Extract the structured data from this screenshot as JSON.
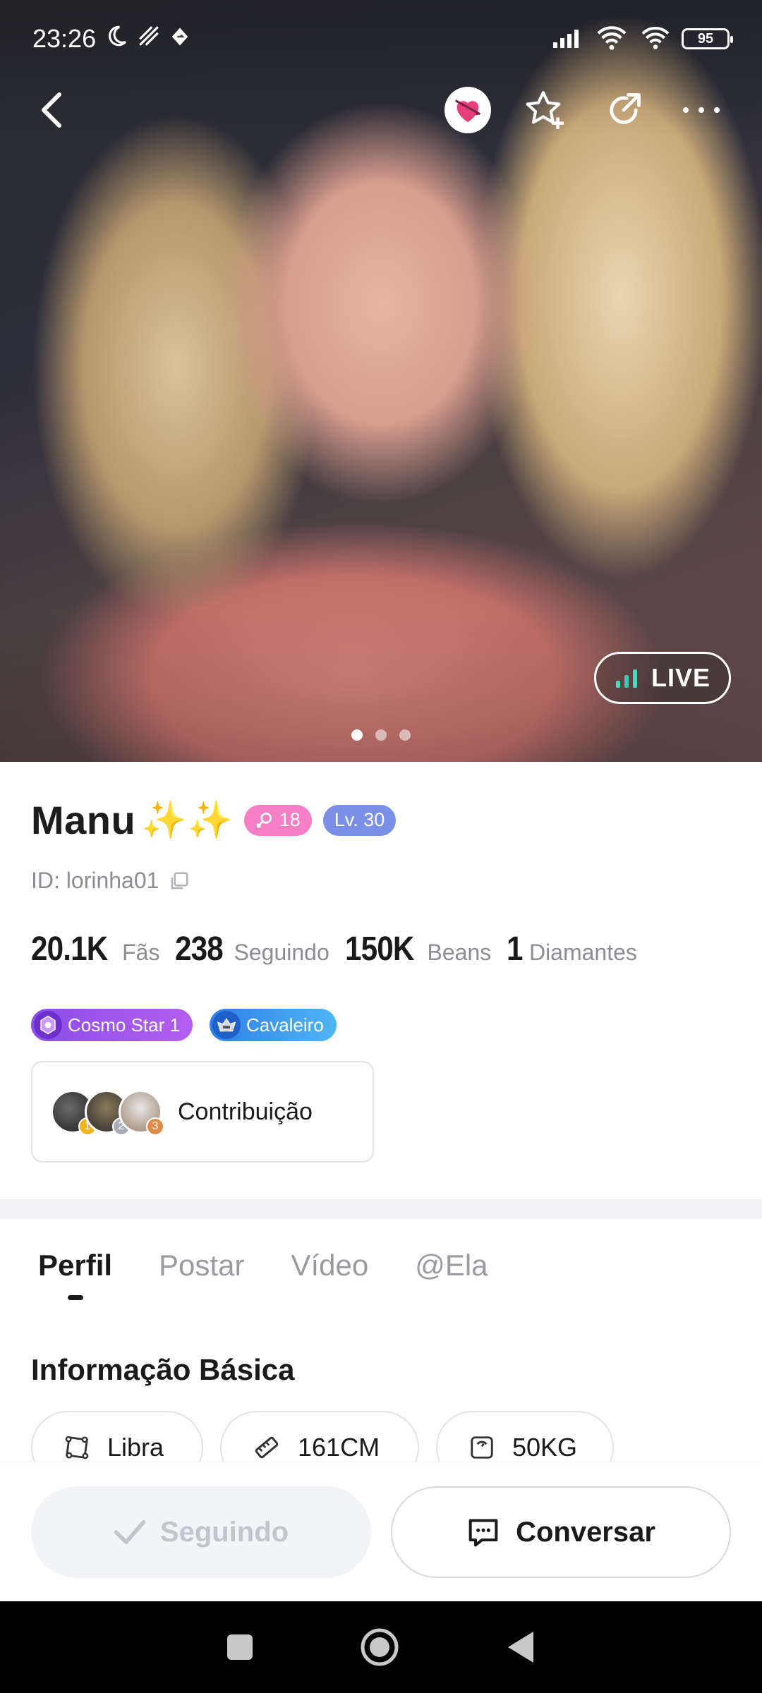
{
  "status_bar": {
    "time": "23:26",
    "battery": "95"
  },
  "live": {
    "label": "LIVE"
  },
  "profile": {
    "name": "Manu",
    "name_emoji": "✨✨",
    "gender_age_badge": "18",
    "level_badge": "Lv. 30",
    "id_text": "ID: lorinha01"
  },
  "stats": [
    {
      "value": "20.1K",
      "label": "Fãs"
    },
    {
      "value": "238",
      "label": "Seguindo"
    },
    {
      "value": "150K",
      "label": "Beans"
    },
    {
      "value": "1",
      "label": "Diamantes"
    }
  ],
  "medals": {
    "cosmo": "Cosmo Star 1",
    "knight": "Cavaleiro"
  },
  "contribution": {
    "label": "Contribuição",
    "ranks": [
      "1",
      "2",
      "3"
    ]
  },
  "tabs": [
    "Perfil",
    "Postar",
    "Vídeo",
    "@Ela"
  ],
  "basic_info": {
    "title": "Informação Básica",
    "chips": [
      "Libra",
      "161CM",
      "50KG"
    ]
  },
  "actions": {
    "following": "Seguindo",
    "chat": "Conversar"
  },
  "colors": {
    "gender_badge": "#f57ec4",
    "level_badge": "#7a8fe6",
    "cosmo": "#9b55ec",
    "knight": "#3a95ee"
  }
}
